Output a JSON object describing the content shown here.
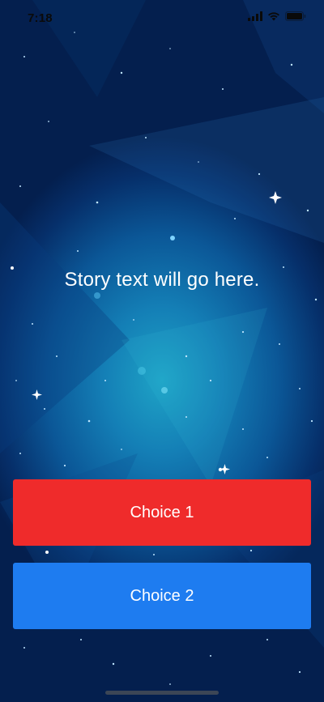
{
  "status_bar": {
    "time": "7:18",
    "icons": [
      "cellular-signal-icon",
      "wifi-icon",
      "battery-icon"
    ]
  },
  "background": {
    "description_icon": "starfield-background"
  },
  "story": {
    "text": "Story text will go here."
  },
  "choices": [
    {
      "label": "Choice 1",
      "color": "#EF2B2B"
    },
    {
      "label": "Choice 2",
      "color": "#1E7CF0"
    }
  ],
  "colors": {
    "text": "#FFFFFF",
    "background_center": "#1EA3C6",
    "background_edge": "#041F4E"
  }
}
